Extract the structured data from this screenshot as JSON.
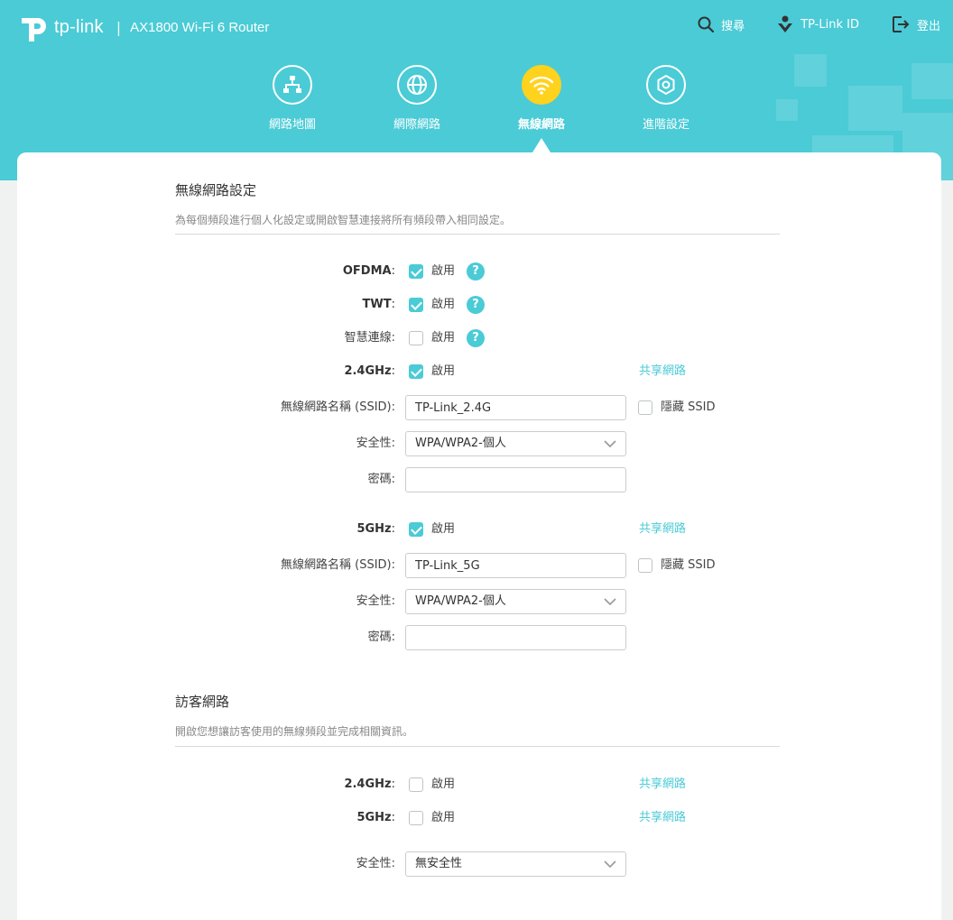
{
  "header": {
    "brand": "tp-link",
    "separator": "|",
    "model": "AX1800 Wi-Fi 6 Router",
    "actions": {
      "search": "搜尋",
      "tplink_id": "TP-Link ID",
      "logout": "登出"
    }
  },
  "nav": {
    "items": [
      {
        "label": "網路地圖",
        "icon": "network-map-icon"
      },
      {
        "label": "網際網路",
        "icon": "globe-icon"
      },
      {
        "label": "無線網路",
        "icon": "wifi-icon",
        "active": true
      },
      {
        "label": "進階設定",
        "icon": "gear-icon"
      }
    ]
  },
  "wireless": {
    "title": "無線網路設定",
    "description": "為每個頻段進行個人化設定或開啟智慧連接將所有頻段帶入相同設定。",
    "ofdma": {
      "label": "OFDMA",
      "option": "啟用",
      "checked": true
    },
    "twt": {
      "label": "TWT",
      "option": "啟用",
      "checked": true
    },
    "smart_connect": {
      "label": "智慧連線",
      "option": "啟用",
      "checked": false
    },
    "colon": ":",
    "band24": {
      "label": "2.4GHz",
      "option": "啟用",
      "checked": true,
      "share_link": "共享網路",
      "ssid_label": "無線網路名稱 (SSID)",
      "ssid_value": "TP-Link_2.4G",
      "hide_ssid_label": "隱藏 SSID",
      "hide_ssid_checked": false,
      "security_label": "安全性",
      "security_value": "WPA/WPA2-個人",
      "password_label": "密碼",
      "password_value": ""
    },
    "band5": {
      "label": "5GHz",
      "option": "啟用",
      "checked": true,
      "share_link": "共享網路",
      "ssid_label": "無線網路名稱 (SSID)",
      "ssid_value": "TP-Link_5G",
      "hide_ssid_label": "隱藏 SSID",
      "hide_ssid_checked": false,
      "security_label": "安全性",
      "security_value": "WPA/WPA2-個人",
      "password_label": "密碼",
      "password_value": ""
    }
  },
  "guest": {
    "title": "訪客網路",
    "description": "開啟您想讓訪客使用的無線頻段並完成相關資訊。",
    "band24": {
      "label": "2.4GHz",
      "option": "啟用",
      "checked": false,
      "share_link": "共享網路"
    },
    "band5": {
      "label": "5GHz",
      "option": "啟用",
      "checked": false,
      "share_link": "共享網路"
    },
    "security_label": "安全性",
    "security_value": "無安全性"
  },
  "colors": {
    "accent": "#4acbd6",
    "active_nav": "#ffd21e",
    "header_bg": "#4acbd6"
  }
}
